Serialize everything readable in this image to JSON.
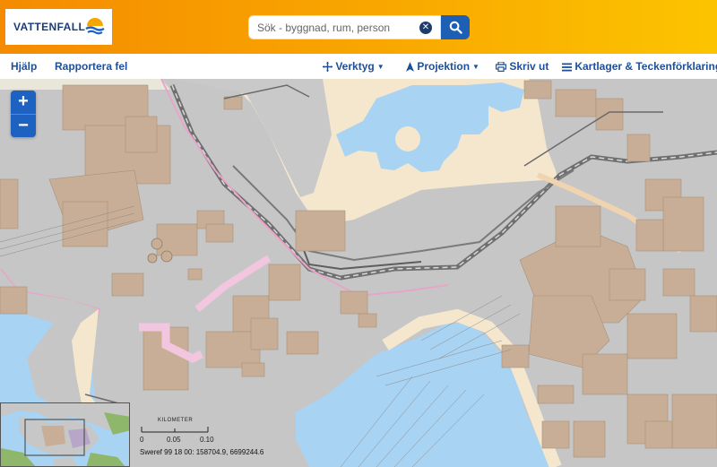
{
  "header": {
    "logo_text": "VATTENFALL",
    "search_placeholder": "Sök - byggnad, rum, person",
    "accent_color": "#f7a000",
    "brand_blue": "#1d5fb4"
  },
  "toolbar": {
    "help": "Hjälp",
    "report": "Rapportera fel",
    "tools": "Verktyg",
    "projection": "Projektion",
    "print": "Skriv ut",
    "layers": "Kartlager & Teckenförklaring"
  },
  "map": {
    "zoom_in": "+",
    "zoom_out": "−",
    "scale": {
      "unit": "KILOMETER",
      "ticks": [
        "0",
        "0.05",
        "0.10"
      ]
    },
    "coordinates": "Sweref 99 18 00: 158704.9, 6699244.6",
    "colors": {
      "building": "#c8b09a",
      "water": "#a9d3f2",
      "land": "#f3e8cf",
      "industrial": "#c7c7c7",
      "boundary": "#e4a4c8"
    }
  },
  "icons": [
    "search-icon",
    "clear-icon",
    "crosshair-icon",
    "navigation-arrow-icon",
    "printer-icon",
    "list-icon"
  ]
}
